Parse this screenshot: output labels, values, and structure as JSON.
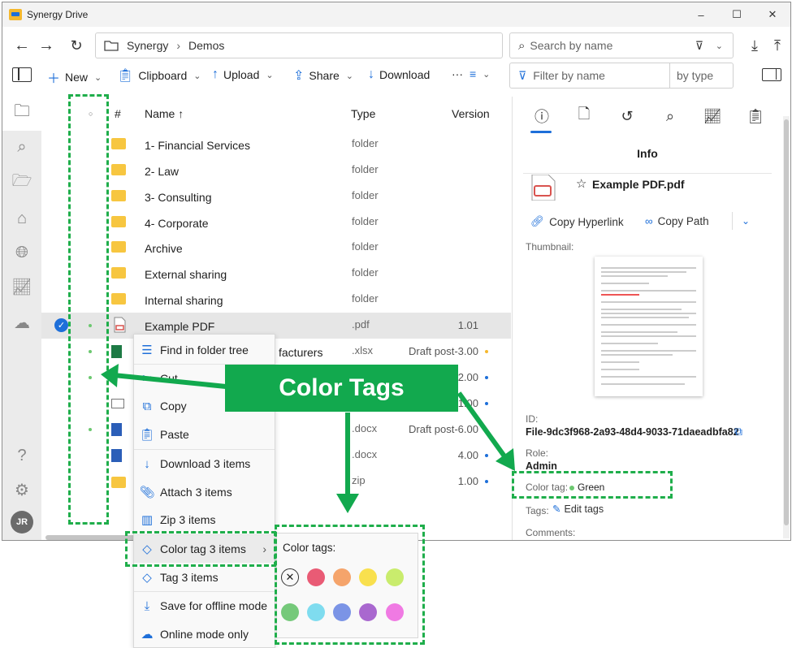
{
  "window": {
    "title": "Synergy Drive",
    "controls": [
      "–",
      "☐",
      "✕"
    ]
  },
  "nav": {
    "breadcrumb": [
      "Synergy",
      "Demos"
    ],
    "search_placeholder": "Search by name"
  },
  "toolbar": {
    "new": "New",
    "clipboard": "Clipboard",
    "upload": "Upload",
    "share": "Share",
    "download": "Download",
    "more": "···",
    "filter_placeholder": "Filter by name",
    "by_type": "by type"
  },
  "columns": {
    "hash": "#",
    "name": "Name ↑",
    "type": "Type",
    "version": "Version"
  },
  "rows": [
    {
      "name": "1- Financial Services",
      "type": "folder",
      "version": ""
    },
    {
      "name": "2- Law",
      "type": "folder",
      "version": ""
    },
    {
      "name": "3- Consulting",
      "type": "folder",
      "version": ""
    },
    {
      "name": "4- Corporate",
      "type": "folder",
      "version": ""
    },
    {
      "name": "Archive",
      "type": "folder",
      "version": ""
    },
    {
      "name": "External sharing",
      "type": "folder",
      "version": ""
    },
    {
      "name": "Internal sharing",
      "type": "folder",
      "version": ""
    },
    {
      "name": "Example PDF",
      "type": ".pdf",
      "version": "1.01"
    },
    {
      "name": "facturers",
      "type": ".xlsx",
      "version": "Draft post-3.00"
    },
    {
      "name": "",
      "type": "",
      "version": "2.00"
    },
    {
      "name": "",
      "type": "",
      "version": "1.00"
    },
    {
      "name": "",
      "type": ".docx",
      "version": "Draft post-6.00"
    },
    {
      "name": "",
      "type": ".docx",
      "version": "4.00"
    },
    {
      "name": "",
      "type": "zip",
      "version": "1.00"
    }
  ],
  "info": {
    "heading": "Info",
    "file_name": "Example PDF.pdf",
    "copy_hyperlink": "Copy Hyperlink",
    "copy_path": "Copy Path",
    "thumbnail_label": "Thumbnail:",
    "id_label": "ID:",
    "id_value": "File-9dc3f968-2a93-48d4-9033-71daeadbfa82",
    "role_label": "Role:",
    "role_value": "Admin",
    "color_tag_label": "Color tag:",
    "color_tag_value": "Green",
    "tags_label": "Tags:",
    "edit_tags": "Edit tags",
    "comments_label": "Comments:"
  },
  "avatar": "JR",
  "context_menu": {
    "items": [
      "Find in folder tree",
      "Cut",
      "Copy",
      "Paste",
      "Download 3 items",
      "Attach 3 items",
      "Zip 3 items",
      "Color tag 3 items",
      "Tag 3 items",
      "Save for offline mode",
      "Online mode only"
    ]
  },
  "submenu": {
    "title": "Color tags:",
    "colors": [
      "#e95b75",
      "#f5a46b",
      "#f9e04e",
      "#c9ec6d",
      "#75c97a",
      "#7fdcef",
      "#7b94e6",
      "#a968cf",
      "#f07ae3"
    ]
  },
  "callout": "Color Tags",
  "accent": "#1e6fd9",
  "annotation_color": "#12a94e"
}
